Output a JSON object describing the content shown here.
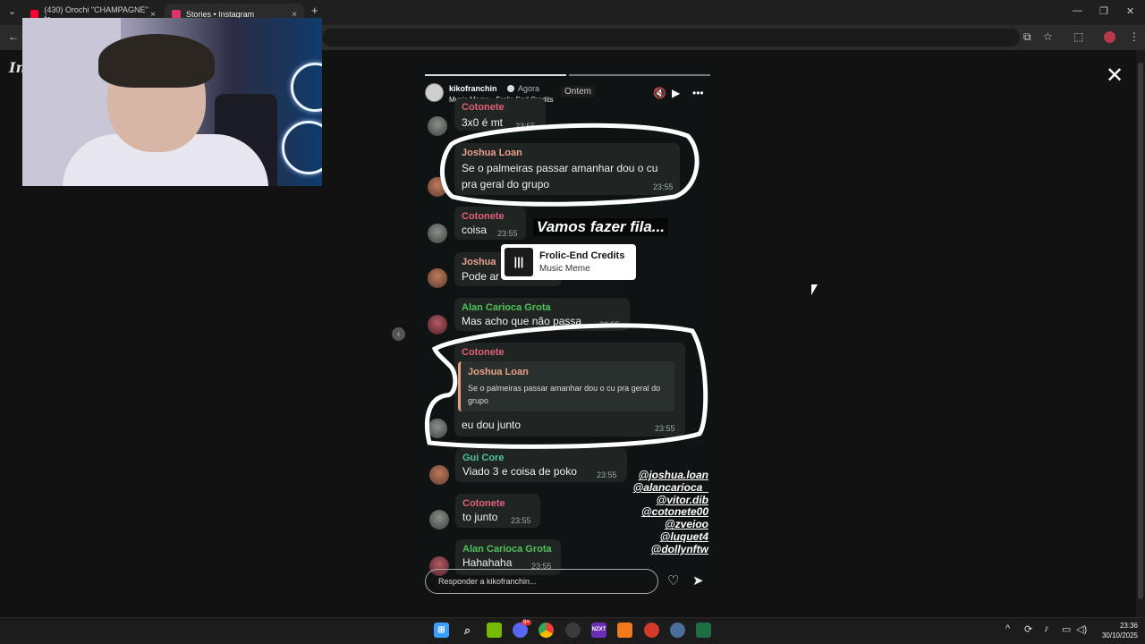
{
  "browser": {
    "tabs": [
      {
        "title": "(430) Orochi \"CHAMPAGNE\" fe",
        "favicon_color": "#ff0033"
      },
      {
        "title": "Stories • Instagram",
        "favicon_color": "#e1306c"
      }
    ],
    "new_tab": "+",
    "tab_close": "×",
    "back": "←",
    "menu": "⋮",
    "window_controls": {
      "minimize": "—",
      "maximize": "❐",
      "close": "✕"
    },
    "extensions": [
      "cast-icon",
      "star-icon",
      "extensions-icon",
      "profile-icon"
    ]
  },
  "instagram": {
    "logo_text": "In"
  },
  "story": {
    "username": "kikofranchin",
    "time_ago": "Agora",
    "music_line": "Music Meme · Frolic-End Credits",
    "date_divider": "Ontem",
    "messages": [
      {
        "sender": "Cotonete",
        "text": "3x0 é mt",
        "time": "23:55",
        "color": "#e0607a"
      },
      {
        "sender": "Joshua Loan",
        "text_lines": [
          "Se o palmeiras passar amanhar dou o cu",
          "pra geral do grupo"
        ],
        "time": "23:55",
        "color": "#e8a08c"
      },
      {
        "sender": "Cotonete",
        "text": "coisa",
        "time": "23:55",
        "color": "#e0607a"
      },
      {
        "sender": "Joshua",
        "text": "Pode ar",
        "time": "",
        "color": "#e8a08c"
      },
      {
        "sender": "Alan Carioca Grota",
        "text": "Mas acho que não passa",
        "time": "23:55",
        "color": "#4fc35a"
      },
      {
        "sender": "Cotonete",
        "quote_sender": "Joshua Loan",
        "quote_text": "Se o palmeiras passar amanhar dou o cu pra geral do grupo",
        "text": "eu dou junto",
        "time": "23:55",
        "color": "#e0607a"
      },
      {
        "sender": "Gui Core",
        "text": "Viado 3 e coisa de poko",
        "time": "23:55",
        "color": "#4fc3a0"
      },
      {
        "sender": "Cotonete",
        "text": "to junto",
        "time": "23:55",
        "color": "#e0607a"
      },
      {
        "sender": "Alan Carioca Grota",
        "text": "Hahahaha",
        "time": "23:55",
        "color": "#4fc35a"
      }
    ],
    "sticker_text": "Vamos fazer fila...",
    "music_sticker": {
      "title": "Frolic-End Credits",
      "artist": "Music Meme"
    },
    "mentions": [
      "@joshua.loan",
      "@alancarioca_",
      "@vitor.dib",
      "@cotonete00",
      "@zveioo",
      "@luquet4",
      "@dollynftw"
    ],
    "reply_placeholder": "Responder a kikofranchin..."
  },
  "taskbar": {
    "apps": [
      "windows-icon",
      "search-icon",
      "nvidia-icon",
      "discord-icon",
      "chrome-icon",
      "obs-icon",
      "nzxt-icon",
      "avast-icon",
      "app-icon",
      "settings-icon",
      "excel-icon"
    ],
    "discord_badge": "9+",
    "nzxt_label": "NZXT",
    "time": "23:36",
    "date": "30/10/2025"
  }
}
